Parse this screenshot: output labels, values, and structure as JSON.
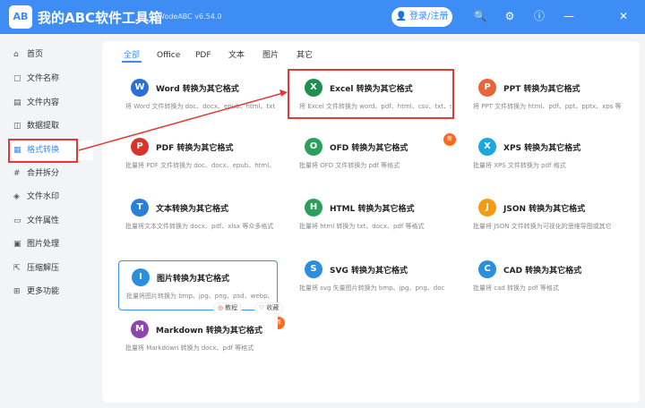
{
  "app": {
    "logo_text": "AB",
    "title": "我的ABC软件工具箱",
    "version": "WodeABC v6.54.0",
    "login_label": "登录/注册",
    "icons": [
      "user-icon",
      "search-icon",
      "settings-icon",
      "info-icon",
      "minimize-icon",
      "close-icon"
    ]
  },
  "sidebar": {
    "items": [
      {
        "label": "首页",
        "icon": "home-icon"
      },
      {
        "label": "文件名称",
        "icon": "file-name-icon"
      },
      {
        "label": "文件内容",
        "icon": "file-content-icon"
      },
      {
        "label": "数据提取",
        "icon": "data-extract-icon"
      },
      {
        "label": "格式转换",
        "icon": "format-convert-icon",
        "active": true
      },
      {
        "label": "合并拆分",
        "icon": "merge-split-icon"
      },
      {
        "label": "文件水印",
        "icon": "watermark-icon"
      },
      {
        "label": "文件属性",
        "icon": "file-attr-icon"
      },
      {
        "label": "图片处理",
        "icon": "image-process-icon"
      },
      {
        "label": "压缩解压",
        "icon": "compress-icon"
      },
      {
        "label": "更多功能",
        "icon": "more-icon"
      }
    ]
  },
  "tabs": [
    "全部",
    "Office",
    "PDF",
    "文本",
    "图片",
    "其它"
  ],
  "cards": [
    {
      "title": "Word 转换为其它格式",
      "desc": "将 Word 文件转换为 doc、docx、epub、html、txt",
      "icon": "W",
      "color": "#2b6fd6"
    },
    {
      "title": "Excel 转换为其它格式",
      "desc": "将 Excel 文件转换为 word、pdf、html、csv、txt、s",
      "icon": "X",
      "color": "#1e8f4e"
    },
    {
      "title": "PPT 转换为其它格式",
      "desc": "将 PPT 文件转换为 html、pdf、ppt、pptx、xps 等",
      "icon": "P",
      "color": "#e8643a"
    },
    {
      "title": "PDF 转换为其它格式",
      "desc": "批量将 PDF 文件转换为 doc、docx、epub、html、",
      "icon": "P",
      "color": "#d9342b"
    },
    {
      "title": "OFD 转换为其它格式",
      "desc": "批量将 OFD 文件转换为 pdf 等格式",
      "icon": "O",
      "color": "#2aa05a"
    },
    {
      "title": "XPS 转换为其它格式",
      "desc": "批量将 XPS 文件转换为 pdf 格式",
      "icon": "X",
      "color": "#1ba8e0"
    },
    {
      "title": "文本转换为其它格式",
      "desc": "批量将文本文件转换为 docx、pdf、xlsx 等众多格式",
      "icon": "T",
      "color": "#2b7fd6"
    },
    {
      "title": "HTML 转换为其它格式",
      "desc": "批量将 html 转换为 txt、docx、pdf 等格式",
      "icon": "H",
      "color": "#2aa05a"
    },
    {
      "title": "JSON 转换为其它格式",
      "desc": "批量将 JSON 文件转换为可视化的思维导图或其它",
      "icon": "J",
      "color": "#f39c12"
    },
    {
      "title": "图片转换为其它格式",
      "desc": "批量将图片转换为 bmp、jpg、png、psd、webp、",
      "icon": "I",
      "color": "#2b8fe0"
    },
    {
      "title": "SVG 转换为其它格式",
      "desc": "批量将 svg 矢量图片转换为 bmp、jpg、png、doc",
      "icon": "S",
      "color": "#2b8fe0"
    },
    {
      "title": "CAD 转换为其它格式",
      "desc": "批量将 cad 转换为 pdf 等格式",
      "icon": "C",
      "color": "#2b8fe0"
    },
    {
      "title": "Markdown 转换为其它格式",
      "desc": "批量将 Markdown 转换为 docx、pdf 等格式",
      "icon": "M",
      "color": "#8e44ad"
    }
  ],
  "badges": {
    "new": "新"
  },
  "card_actions": {
    "tutorial": "教程",
    "favorite": "收藏"
  }
}
